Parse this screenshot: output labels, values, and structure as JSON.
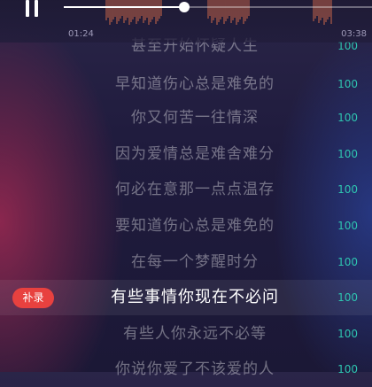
{
  "player": {
    "current_time": "01:24",
    "total_time": "03:38",
    "progress": 0.39,
    "pause_icon": "pause-icon"
  },
  "colors": {
    "accent": "#2ec4b0",
    "record_button": "#e8413f",
    "waveform": "#c9664a",
    "background": "#1f1b3d"
  },
  "lyrics": [
    {
      "text": "甚至开始怀疑人生",
      "score": "100"
    },
    {
      "text": "早知道伤心总是难免的",
      "score": "100"
    },
    {
      "text": "你又何苦一往情深",
      "score": "100"
    },
    {
      "text": "因为爱情总是难舍难分",
      "score": "100"
    },
    {
      "text": "何必在意那一点点温存",
      "score": "100"
    },
    {
      "text": "要知道伤心总是难免的",
      "score": "100"
    },
    {
      "text": "在每一个梦醒时分",
      "score": "100"
    },
    {
      "text": "有些事情你现在不必问",
      "score": "100"
    },
    {
      "text": "有些人你永远不必等",
      "score": "100"
    },
    {
      "text": "你说你爱了不该爱的人",
      "score": "100"
    }
  ],
  "current_index": 7,
  "record_button_label": "补录"
}
